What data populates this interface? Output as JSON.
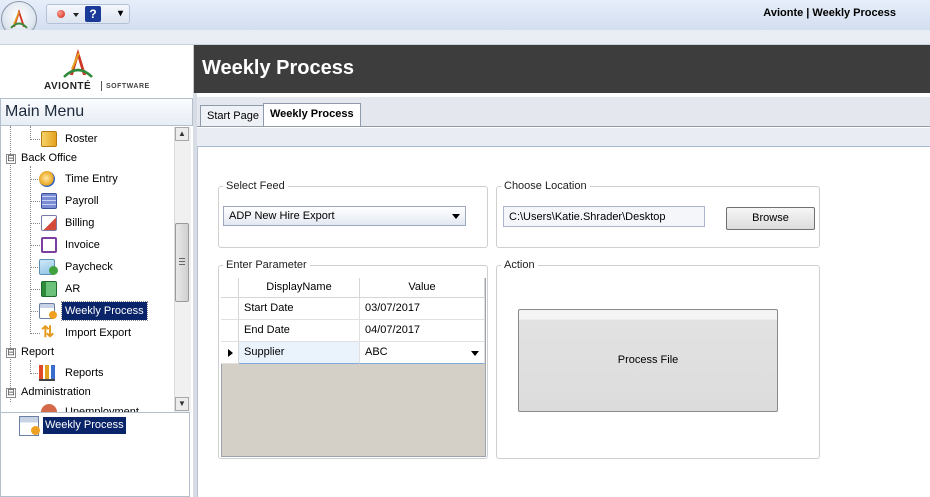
{
  "window": {
    "title": "Avionte | Weekly Process"
  },
  "logo": {
    "brand": "AVIONTÉ",
    "suffix": "SOFTWARE"
  },
  "header": {
    "title": "Weekly Process"
  },
  "sidebar": {
    "title": "Main Menu",
    "items": [
      {
        "label": "Roster",
        "icon": "roster-icon",
        "level": 2
      },
      {
        "label": "Back Office",
        "level": 1,
        "expander": "⊟"
      },
      {
        "label": "Time Entry",
        "icon": "clock-icon",
        "level": 2
      },
      {
        "label": "Payroll",
        "icon": "calculator-icon",
        "level": 2
      },
      {
        "label": "Billing",
        "icon": "billing-icon",
        "level": 2
      },
      {
        "label": "Invoice",
        "icon": "invoice-icon",
        "level": 2
      },
      {
        "label": "Paycheck",
        "icon": "paycheck-icon",
        "level": 2
      },
      {
        "label": "AR",
        "icon": "ledger-icon",
        "level": 2
      },
      {
        "label": "Weekly Process",
        "icon": "calendar-gear-icon",
        "level": 2,
        "selected": true
      },
      {
        "label": "Import Export",
        "icon": "import-export-icon",
        "level": 2
      },
      {
        "label": "Report",
        "level": 1,
        "expander": "⊟"
      },
      {
        "label": "Reports",
        "icon": "chart-icon",
        "level": 2
      },
      {
        "label": "Administration",
        "level": 1,
        "expander": "⊟"
      },
      {
        "label": "Unemployment",
        "icon": "unemployment-icon",
        "level": 2
      }
    ],
    "bottom_item": "Weekly Process"
  },
  "tabs": [
    {
      "label": "Start Page",
      "active": false
    },
    {
      "label": "Weekly Process",
      "active": true
    }
  ],
  "select_feed": {
    "legend": "Select Feed",
    "value": "ADP New Hire Export"
  },
  "choose_location": {
    "legend": "Choose Location",
    "value": "C:\\Users\\Katie.Shrader\\Desktop",
    "browse_label": "Browse"
  },
  "enter_parameter": {
    "legend": "Enter Parameter",
    "columns": [
      "DisplayName",
      "Value"
    ],
    "rows": [
      {
        "name": "Start Date",
        "value": "03/07/2017"
      },
      {
        "name": "End Date",
        "value": "04/07/2017"
      },
      {
        "name": "Supplier",
        "value": "ABC"
      }
    ]
  },
  "action": {
    "legend": "Action",
    "button_label": "Process File"
  },
  "colors": {
    "header_bg": "#3d3d3d",
    "selection": "#0a246a"
  }
}
